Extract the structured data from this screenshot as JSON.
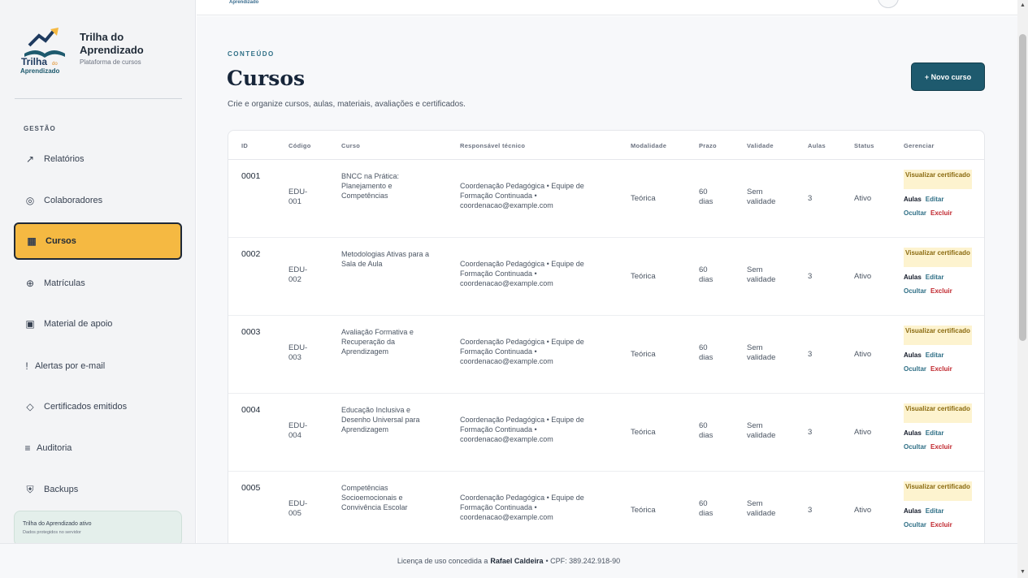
{
  "brand": {
    "title": "Trilha do Aprendizado",
    "subtitle": "Plataforma de cursos",
    "logo_text_1": "Trilha",
    "logo_text_2": "do",
    "logo_text_3": "Aprendizado"
  },
  "topbar": {
    "mini_brand": "Aprendizado"
  },
  "sidebar": {
    "section": "GESTÃO",
    "items": [
      {
        "label": "Relatórios",
        "icon": "trend-icon"
      },
      {
        "label": "Colaboradores",
        "icon": "target-icon"
      },
      {
        "label": "Cursos",
        "icon": "grid-icon",
        "active": true
      },
      {
        "label": "Matrículas",
        "icon": "crosshair-icon"
      },
      {
        "label": "Material de apoio",
        "icon": "square-icon"
      },
      {
        "label": "Alertas por e-mail",
        "icon": "exclamation-icon"
      },
      {
        "label": "Certificados emitidos",
        "icon": "diamond-icon"
      },
      {
        "label": "Auditoria",
        "icon": "lines-icon"
      },
      {
        "label": "Backups",
        "icon": "shield-icon"
      }
    ],
    "status_title": "Trilha do Aprendizado ativo",
    "status_sub": "Dados protegidos no servidor"
  },
  "header": {
    "eyebrow": "CONTEÚDO",
    "title": "Cursos",
    "description": "Crie e organize cursos, aulas, materiais, avaliações e certificados.",
    "new_button": "+ Novo curso"
  },
  "table": {
    "columns": [
      "ID",
      "Código",
      "Curso",
      "Responsável técnico",
      "Modalidade",
      "Prazo",
      "Validade",
      "Aulas",
      "Status",
      "Gerenciar"
    ],
    "actions": {
      "certificate": "Visualizar certificado",
      "lessons": "Aulas",
      "edit": "Editar",
      "hide": "Ocultar",
      "delete": "Excluir"
    },
    "rows": [
      {
        "id": "0001",
        "code": "EDU-001",
        "course": "BNCC na Prática: Planejamento e Competências",
        "responsible": "Coordenação Pedagógica • Equipe de Formação Continuada • coordenacao@example.com",
        "modality": "Teórica",
        "deadline": "60 dias",
        "validity": "Sem validade",
        "lessons": "3",
        "status": "Ativo"
      },
      {
        "id": "0002",
        "code": "EDU-002",
        "course": "Metodologias Ativas para a Sala de Aula",
        "responsible": "Coordenação Pedagógica • Equipe de Formação Continuada • coordenacao@example.com",
        "modality": "Teórica",
        "deadline": "60 dias",
        "validity": "Sem validade",
        "lessons": "3",
        "status": "Ativo"
      },
      {
        "id": "0003",
        "code": "EDU-003",
        "course": "Avaliação Formativa e Recuperação da Aprendizagem",
        "responsible": "Coordenação Pedagógica • Equipe de Formação Continuada • coordenacao@example.com",
        "modality": "Teórica",
        "deadline": "60 dias",
        "validity": "Sem validade",
        "lessons": "3",
        "status": "Ativo"
      },
      {
        "id": "0004",
        "code": "EDU-004",
        "course": "Educação Inclusiva e Desenho Universal para Aprendizagem",
        "responsible": "Coordenação Pedagógica • Equipe de Formação Continuada • coordenacao@example.com",
        "modality": "Teórica",
        "deadline": "60 dias",
        "validity": "Sem validade",
        "lessons": "3",
        "status": "Ativo"
      },
      {
        "id": "0005",
        "code": "EDU-005",
        "course": "Competências Socioemocionais e Convivência Escolar",
        "responsible": "Coordenação Pedagógica • Equipe de Formação Continuada • coordenacao@example.com",
        "modality": "Teórica",
        "deadline": "60 dias",
        "validity": "Sem validade",
        "lessons": "3",
        "status": "Ativo"
      }
    ]
  },
  "footer": {
    "prefix": "Licença de uso concedida a",
    "name": "Rafael Caldeira",
    "suffix": "• CPF: 389.242.918-90"
  },
  "colors": {
    "accent": "#f5b942",
    "primary": "#1e5a6e",
    "danger": "#c0262d"
  }
}
